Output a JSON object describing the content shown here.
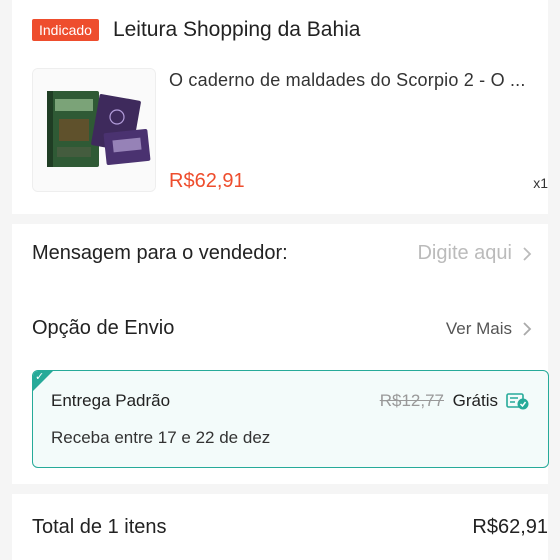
{
  "shop": {
    "badge": "Indicado",
    "name": "Leitura Shopping da Bahia"
  },
  "product": {
    "title": "O caderno de maldades do Scorpio 2 - O ...",
    "price": "R$62,91",
    "quantity": "x1"
  },
  "message": {
    "label": "Mensagem para o vendedor:",
    "placeholder": "Digite aqui"
  },
  "shipping": {
    "label": "Opção de Envio",
    "more_link": "Ver Mais",
    "option": {
      "name": "Entrega Padrão",
      "original_price": "R$12,77",
      "price": "Grátis",
      "eta": "Receba entre 17 e 22 de dez"
    }
  },
  "total": {
    "label": "Total de 1 itens",
    "value": "R$62,91"
  },
  "colors": {
    "accent": "#ee4d2d",
    "shipping_border": "#26aa99"
  }
}
